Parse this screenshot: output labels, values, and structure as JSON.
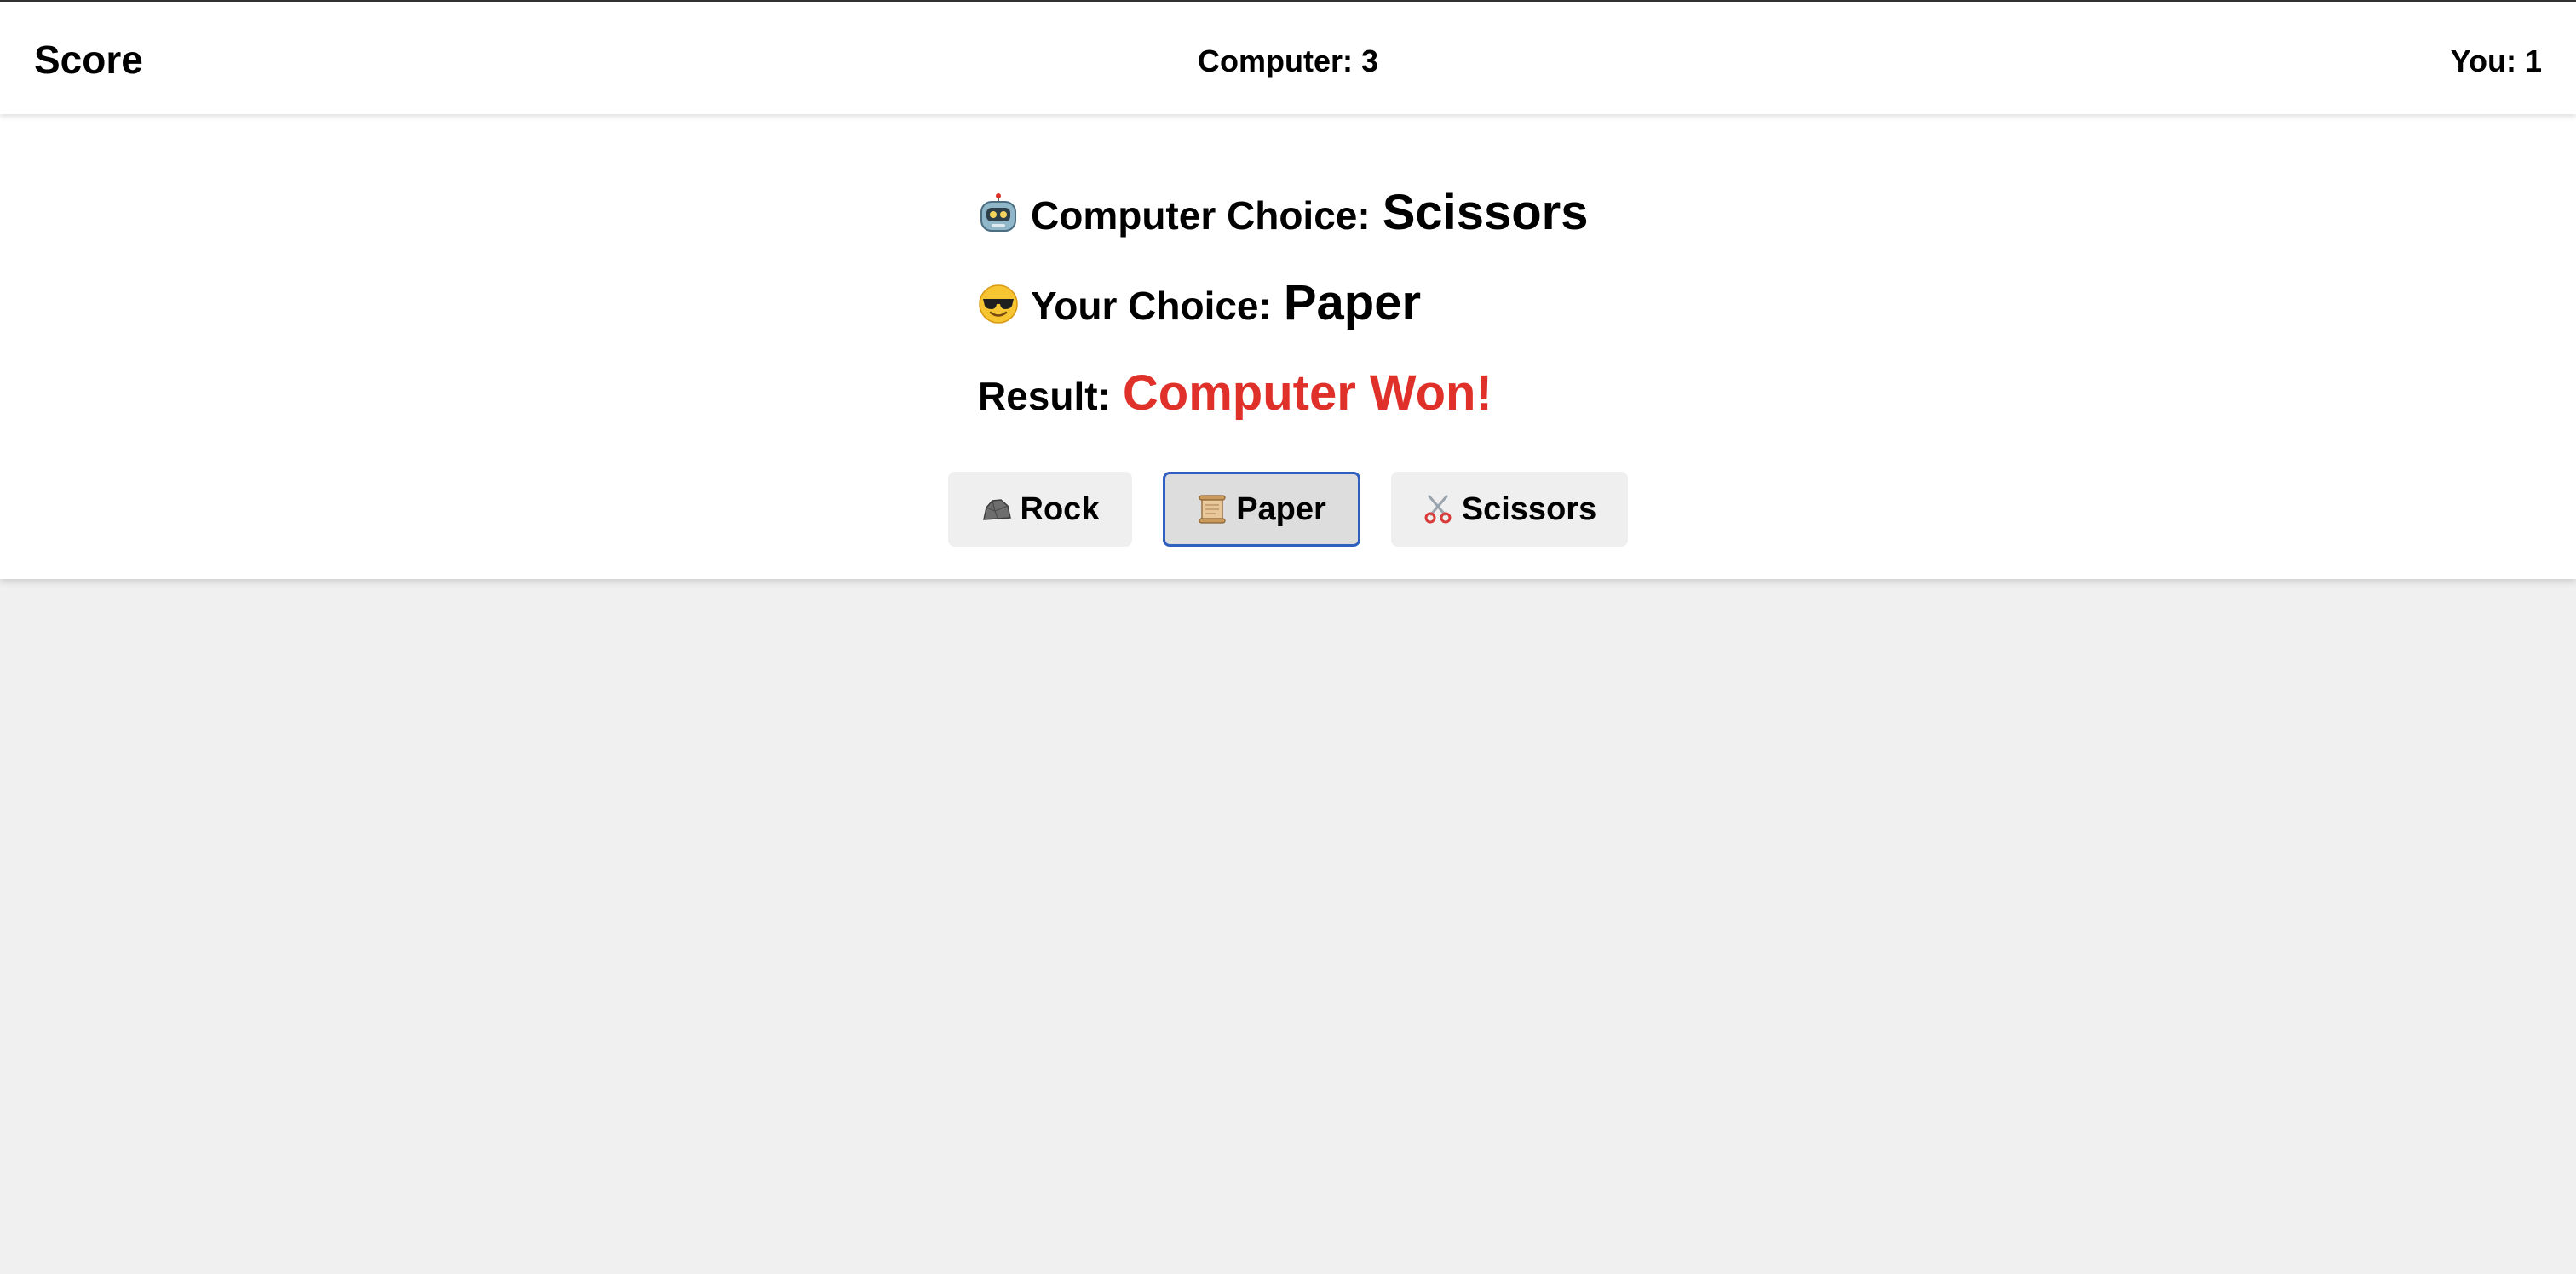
{
  "header": {
    "title": "Score",
    "computer_score": "Computer: 3",
    "you_score": "You: 1"
  },
  "game": {
    "computer_choice_label": "Computer Choice:",
    "computer_choice_value": "Scissors",
    "your_choice_label": "Your Choice:",
    "your_choice_value": "Paper",
    "result_label": "Result:",
    "result_value": "Computer Won!",
    "icons": {
      "computer": "robot-face-icon",
      "you": "sunglasses-face-icon"
    }
  },
  "buttons": [
    {
      "label": "Rock",
      "icon": "rock-icon",
      "selected": false
    },
    {
      "label": "Paper",
      "icon": "scroll-icon",
      "selected": true
    },
    {
      "label": "Scissors",
      "icon": "scissors-icon",
      "selected": false
    }
  ],
  "colors": {
    "result": "#e0302a",
    "selected_border": "#2f5fbf",
    "background": "#f0f0f0",
    "panel": "#ffffff"
  }
}
